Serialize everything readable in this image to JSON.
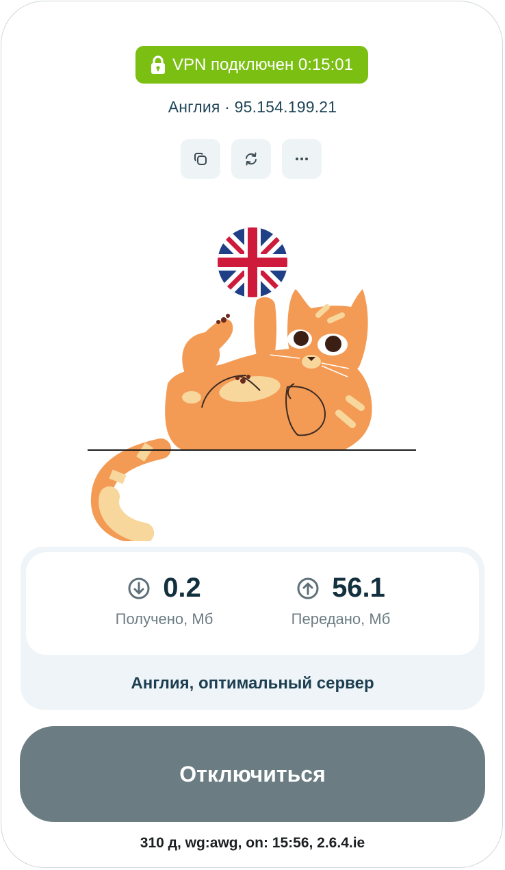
{
  "status": {
    "text": "VPN подключен 0:15:01",
    "color": "#7bbf13",
    "icon": "lock-icon"
  },
  "location": "Англия · 95.154.199.21",
  "actions": [
    {
      "icon": "copy-icon"
    },
    {
      "icon": "refresh-icon"
    },
    {
      "icon": "more-icon"
    }
  ],
  "illustration": {
    "flag": "uk-flag",
    "mascot": "cat"
  },
  "stats": {
    "received": {
      "value": "0.2",
      "label": "Получено, Мб",
      "icon": "download-icon"
    },
    "sent": {
      "value": "56.1",
      "label": "Передано, Мб",
      "icon": "upload-icon"
    }
  },
  "server": "Англия, оптимальный сервер",
  "disconnect_label": "Отключиться",
  "footer": "310 д, wg:awg, on: 15:56, 2.6.4.ie"
}
